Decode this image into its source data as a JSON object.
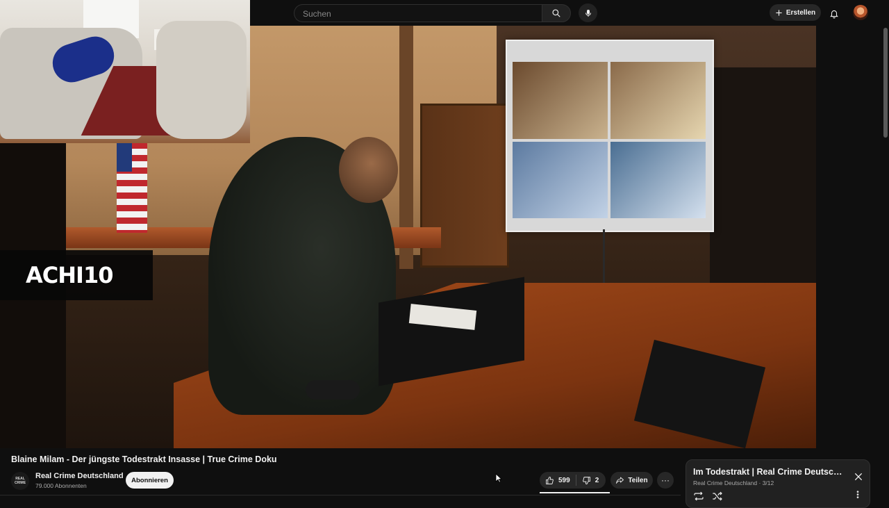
{
  "search": {
    "placeholder": "Suchen"
  },
  "header": {
    "create_label": "Erstellen"
  },
  "video": {
    "overlay_logo_text": "ACHI10",
    "title": "Blaine Milam - Der jüngste Todestrakt Insasse | True Crime Doku"
  },
  "channel": {
    "name": "Real Crime Deutschland",
    "subscribers": "79.000 Abonnenten",
    "avatar_text_1": "REAL",
    "avatar_text_2": "CRIME",
    "subscribe_label": "Abonnieren"
  },
  "actions": {
    "likes": "599",
    "dislikes": "2",
    "share_label": "Teilen",
    "more_label": "···"
  },
  "playlist": {
    "title": "Im Todestrakt | Real Crime Deutschland",
    "channel": "Real Crime Deutschland",
    "position": "3/12"
  },
  "colors": {
    "background": "#0f0f0f",
    "chip": "#272727",
    "subscribe_bg": "#f1f1f1",
    "muted_text": "#aaaaaa"
  },
  "icons": {
    "search": "search-icon",
    "mic": "mic-icon",
    "create": "plus-icon",
    "notifications": "bell-icon",
    "like": "thumbs-up-icon",
    "dislike": "thumbs-down-icon",
    "share": "share-arrow-icon",
    "close": "close-icon",
    "loop": "loop-icon",
    "shuffle": "shuffle-icon"
  }
}
